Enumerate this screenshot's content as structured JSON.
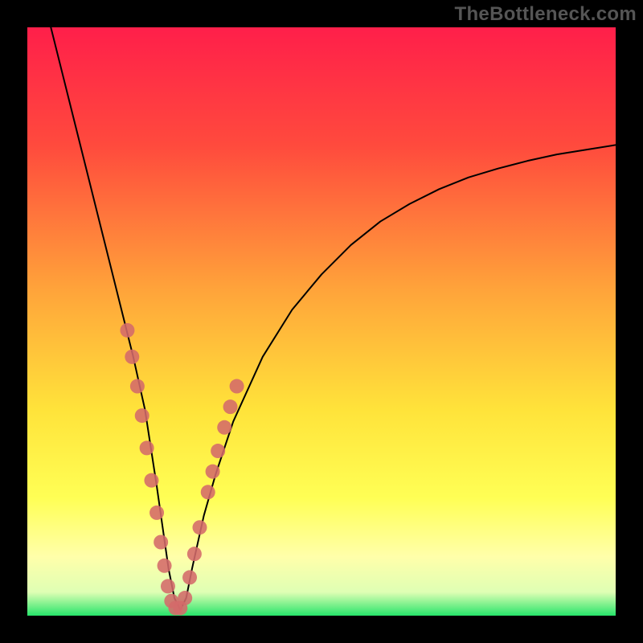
{
  "attribution": "TheBottleneck.com",
  "chart_data": {
    "type": "line",
    "title": "",
    "xlabel": "",
    "ylabel": "",
    "xlim": [
      0,
      100
    ],
    "ylim": [
      0,
      100
    ],
    "grid": false,
    "legend": false,
    "background_gradient": {
      "type": "vertical",
      "stops": [
        {
          "pos": 0.0,
          "color": "#ff1f4a"
        },
        {
          "pos": 0.2,
          "color": "#ff4a3d"
        },
        {
          "pos": 0.45,
          "color": "#ffa53a"
        },
        {
          "pos": 0.65,
          "color": "#ffe33a"
        },
        {
          "pos": 0.8,
          "color": "#ffff55"
        },
        {
          "pos": 0.9,
          "color": "#ffffaa"
        },
        {
          "pos": 0.96,
          "color": "#dfffb4"
        },
        {
          "pos": 1.0,
          "color": "#27e46a"
        }
      ]
    },
    "series": [
      {
        "name": "bottleneck-curve",
        "color": "#000000",
        "stroke_width": 2,
        "x": [
          4,
          6,
          8,
          10,
          12,
          14,
          16,
          18,
          20,
          22,
          23,
          24,
          25,
          26,
          27,
          28,
          30,
          32,
          35,
          40,
          45,
          50,
          55,
          60,
          65,
          70,
          75,
          80,
          85,
          90,
          95,
          100
        ],
        "y": [
          100,
          92,
          84,
          76,
          68,
          60,
          52,
          44,
          35,
          22,
          15,
          8,
          3,
          1,
          3,
          8,
          17,
          24,
          33,
          44,
          52,
          58,
          63,
          67,
          70,
          72.5,
          74.5,
          76,
          77.3,
          78.4,
          79.2,
          80
        ]
      },
      {
        "name": "highlight-dots",
        "type": "scatter",
        "color": "#d46a6a",
        "marker_radius": 9,
        "x": [
          17.0,
          17.8,
          18.7,
          19.5,
          20.3,
          21.1,
          22.0,
          22.7,
          23.3,
          23.9,
          24.5,
          25.2,
          26.0,
          26.8,
          27.6,
          28.4,
          29.3,
          30.7,
          31.5,
          32.4,
          33.5,
          34.5,
          35.6
        ],
        "y": [
          48.5,
          44.0,
          39.0,
          34.0,
          28.5,
          23.0,
          17.5,
          12.5,
          8.5,
          5.0,
          2.5,
          1.3,
          1.3,
          3.0,
          6.5,
          10.5,
          15.0,
          21.0,
          24.5,
          28.0,
          32.0,
          35.5,
          39.0
        ]
      }
    ]
  }
}
